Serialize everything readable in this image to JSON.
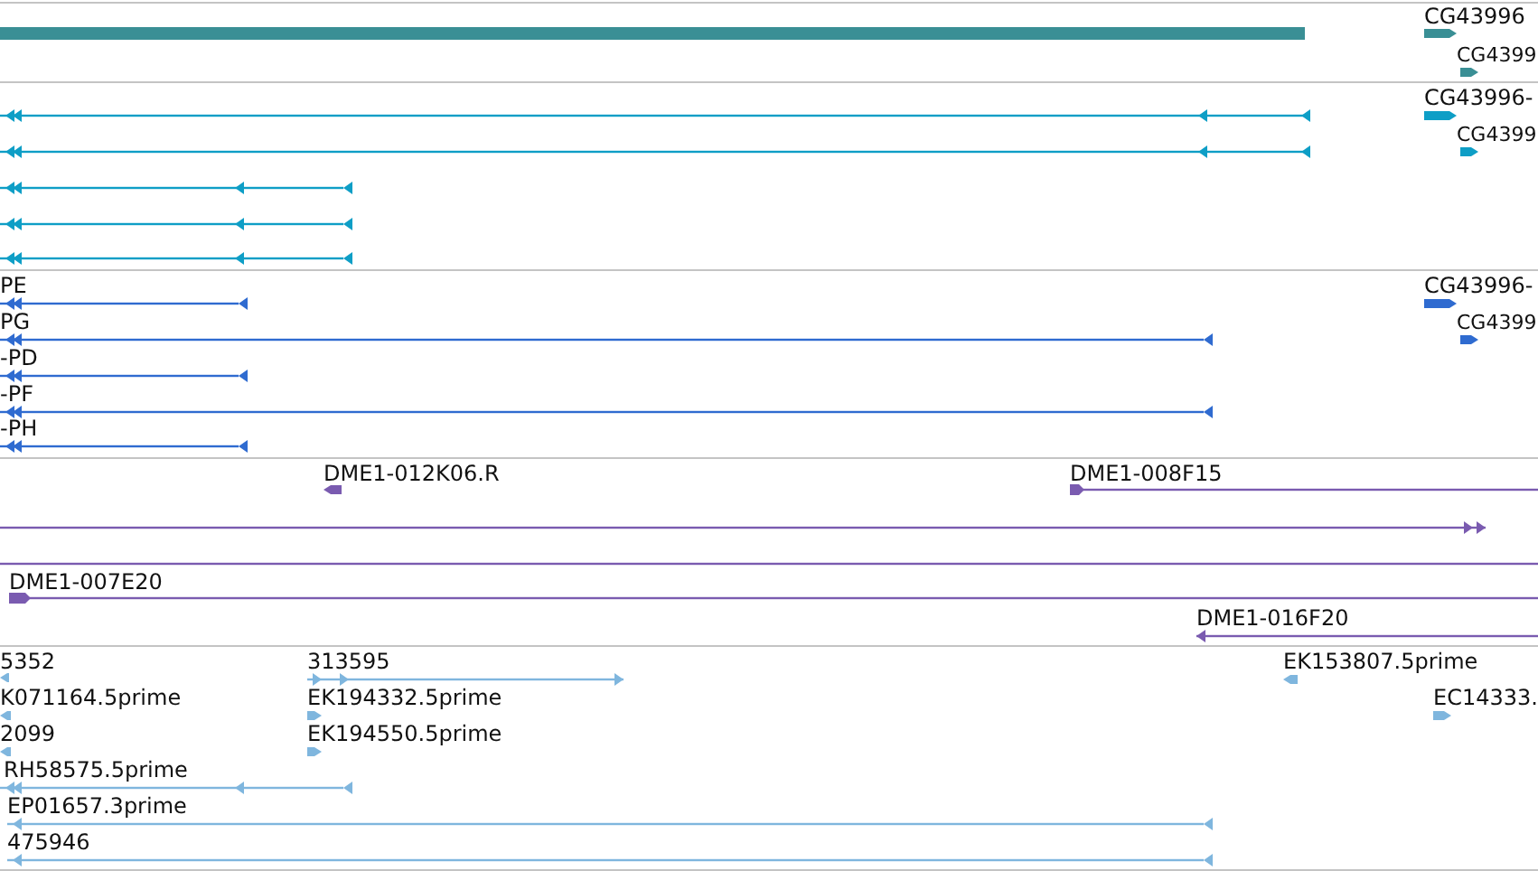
{
  "tracks": [
    {
      "color": "#3a8f95",
      "features": [
        {
          "kind": "block"
        },
        {
          "kind": "block",
          "label": "CG43996"
        },
        {
          "kind": "block",
          "label": "CG4399"
        }
      ]
    },
    {
      "color": "#0e9ec6",
      "features": [
        {
          "kind": "line"
        },
        {
          "kind": "line"
        },
        {
          "kind": "line"
        },
        {
          "kind": "line"
        },
        {
          "kind": "line"
        },
        {
          "kind": "block",
          "label": "CG43996-"
        },
        {
          "kind": "block",
          "label": "CG4399"
        }
      ]
    },
    {
      "color": "#2f6bd0",
      "features": [
        {
          "kind": "line",
          "label": "PE"
        },
        {
          "kind": "line",
          "label": "PG"
        },
        {
          "kind": "line",
          "label": "-PD"
        },
        {
          "kind": "line",
          "label": "-PF"
        },
        {
          "kind": "line",
          "label": "-PH"
        },
        {
          "kind": "block",
          "label": "CG43996-"
        },
        {
          "kind": "block",
          "label": "CG4399"
        }
      ]
    },
    {
      "color": "#7a5bb0",
      "features": [
        {
          "kind": "block",
          "label": "DME1-012K06.R"
        },
        {
          "kind": "line",
          "label": "DME1-008F15"
        },
        {
          "kind": "line"
        },
        {
          "kind": "line"
        },
        {
          "kind": "line",
          "label": "DME1-007E20"
        },
        {
          "kind": "line",
          "label": "DME1-016F20"
        }
      ]
    },
    {
      "color": "#7fb6de",
      "features": [
        {
          "kind": "block",
          "label": "5352"
        },
        {
          "kind": "line",
          "label": "313595"
        },
        {
          "kind": "block",
          "label": "EK153807.5prime"
        },
        {
          "kind": "block",
          "label": "K071164.5prime"
        },
        {
          "kind": "block",
          "label": "EK194332.5prime"
        },
        {
          "kind": "block",
          "label": "EC14333."
        },
        {
          "kind": "block",
          "label": "2099"
        },
        {
          "kind": "block",
          "label": "EK194550.5prime"
        },
        {
          "kind": "line",
          "label": "RH58575.5prime"
        },
        {
          "kind": "line",
          "label": "EP01657.3prime"
        },
        {
          "kind": "line",
          "label": "475946"
        }
      ]
    }
  ]
}
